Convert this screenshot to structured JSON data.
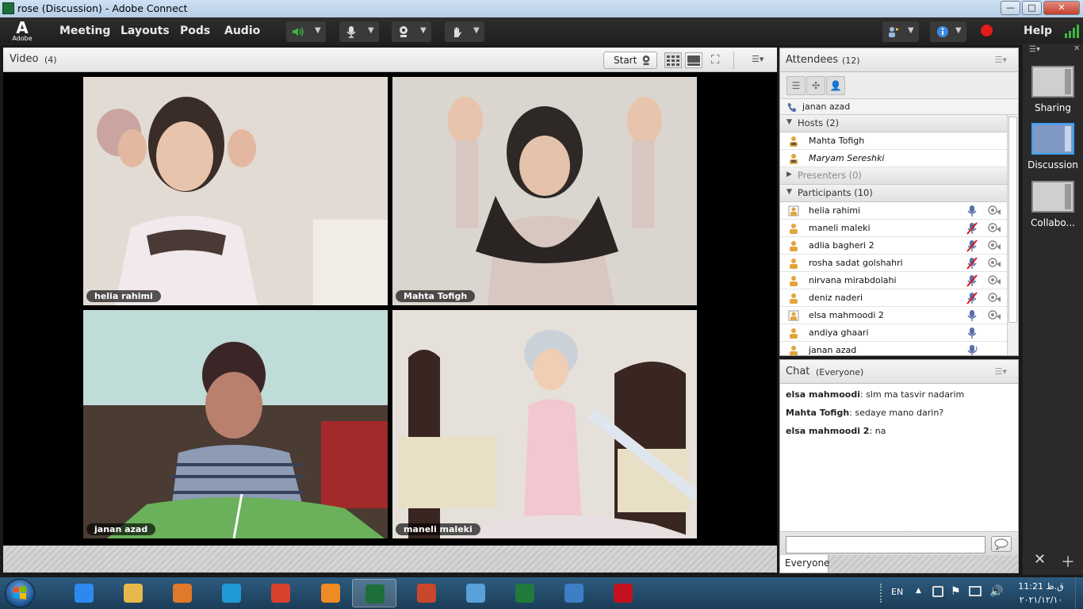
{
  "window": {
    "title": "rose (Discussion) - Adobe Connect",
    "controls": {
      "minimize": "—",
      "maximize": "□",
      "close": "✕"
    }
  },
  "app": {
    "logo_text": "Adobe",
    "menu": [
      "Meeting",
      "Layouts",
      "Pods",
      "Audio"
    ],
    "help_label": "Help"
  },
  "video_pod": {
    "title": "Video",
    "count": "(4)",
    "start_label": "Start",
    "tiles": [
      {
        "name": "helia rahimi",
        "wall": "#ded7d0"
      },
      {
        "name": "Mahta Tofigh",
        "wall": "#d8d3cc"
      },
      {
        "name": "janan azad",
        "wall": "#bcd9d8"
      },
      {
        "name": "maneli maleki",
        "wall": "#e6e2dc"
      }
    ]
  },
  "attendees_pod": {
    "title": "Attendees",
    "count": "(12)",
    "speaking_now": "janan azad",
    "groups": {
      "hosts": "Hosts (2)",
      "presenters": "Presenters (0)",
      "participants": "Participants (10)"
    },
    "hosts": [
      {
        "name": "Mahta Tofigh",
        "italic": false
      },
      {
        "name": "Maryam Sereshki",
        "italic": true
      }
    ],
    "participants": [
      {
        "name": "helia rahimi",
        "mic": "on",
        "cam": true,
        "status": "cam"
      },
      {
        "name": "maneli maleki",
        "mic": "off",
        "cam": true,
        "status": "plain"
      },
      {
        "name": "adlia bagheri 2",
        "mic": "off",
        "cam": true,
        "status": "plain"
      },
      {
        "name": "rosha sadat golshahri",
        "mic": "off",
        "cam": true,
        "status": "plain"
      },
      {
        "name": "nirvana mirabdolahi",
        "mic": "off",
        "cam": true,
        "status": "plain"
      },
      {
        "name": "deniz naderi",
        "mic": "off",
        "cam": true,
        "status": "plain"
      },
      {
        "name": "elsa mahmoodi 2",
        "mic": "on",
        "cam": true,
        "status": "cam"
      },
      {
        "name": "andiya ghaari",
        "mic": "on",
        "cam": false,
        "status": "plain"
      },
      {
        "name": "janan azad",
        "mic": "speaking",
        "cam": false,
        "status": "plain"
      }
    ]
  },
  "chat_pod": {
    "title": "Chat",
    "scope": "(Everyone)",
    "messages": [
      {
        "from": "elsa mahmoodi",
        "text": "slm ma tasvir nadarim"
      },
      {
        "from": "Mahta Tofigh",
        "text": "sedaye mano darin?"
      },
      {
        "from": "elsa mahmoodi 2",
        "text": "na"
      }
    ],
    "input_value": "",
    "tab_label": "Everyone"
  },
  "layouts_panel": {
    "items": [
      {
        "label": "Sharing",
        "selected": false
      },
      {
        "label": "Discussion",
        "selected": true
      },
      {
        "label": "Collabo...",
        "selected": false
      }
    ]
  },
  "taskbar": {
    "apps": [
      {
        "name": "internet-explorer",
        "color": "#2d89ef"
      },
      {
        "name": "file-explorer",
        "color": "#e8b84a"
      },
      {
        "name": "media-player",
        "color": "#e07a2a"
      },
      {
        "name": "edge",
        "color": "#1f9ad6"
      },
      {
        "name": "chrome",
        "color": "#d9412f"
      },
      {
        "name": "firefox",
        "color": "#f08a24"
      },
      {
        "name": "adobe-connect",
        "color": "#1e6e3c"
      },
      {
        "name": "powerpoint",
        "color": "#c9472a"
      },
      {
        "name": "paint",
        "color": "#5aa0d8"
      },
      {
        "name": "excel",
        "color": "#1f7a3c"
      },
      {
        "name": "photos",
        "color": "#3c7fc4"
      },
      {
        "name": "acrobat",
        "color": "#c2121f"
      }
    ],
    "active_app": "adobe-connect",
    "language": "EN",
    "clock_time": "11:21 ق.ظ",
    "clock_date": "۲۰۲۱/۱۲/۱۰"
  },
  "colors": {
    "accent_blue": "#3aa0ff",
    "record_red": "#e21b1b",
    "mic_green": "#3cb83c"
  }
}
